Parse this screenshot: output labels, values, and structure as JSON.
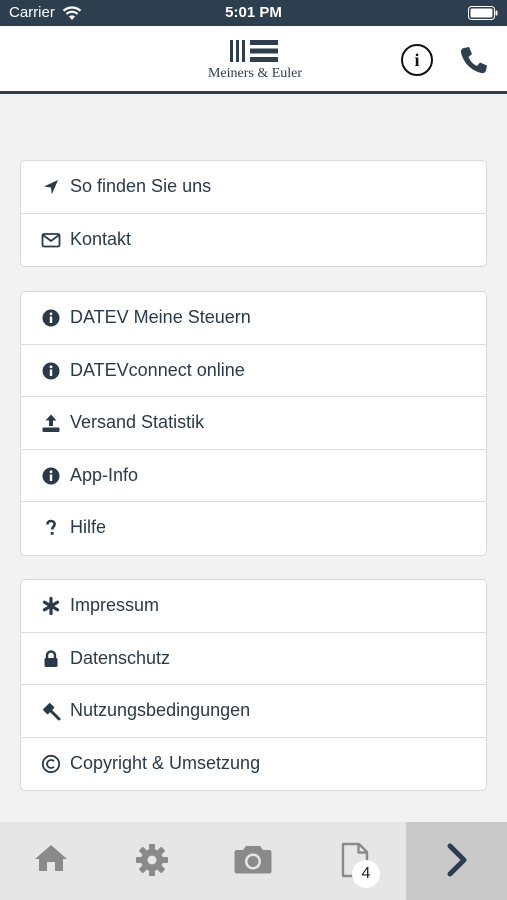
{
  "status_bar": {
    "carrier": "Carrier",
    "time": "5:01 PM"
  },
  "header": {
    "logo_text": "Meiners & Euler"
  },
  "groups": [
    {
      "items": [
        {
          "icon": "location-arrow-icon",
          "label": "So finden Sie uns"
        },
        {
          "icon": "envelope-icon",
          "label": "Kontakt"
        }
      ]
    },
    {
      "items": [
        {
          "icon": "info-circle-icon",
          "label": "DATEV Meine Steuern"
        },
        {
          "icon": "info-circle-icon",
          "label": "DATEVconnect online"
        },
        {
          "icon": "upload-icon",
          "label": "Versand Statistik"
        },
        {
          "icon": "info-circle-icon",
          "label": "App-Info"
        },
        {
          "icon": "question-icon",
          "label": "Hilfe"
        }
      ]
    },
    {
      "items": [
        {
          "icon": "asterisk-icon",
          "label": "Impressum"
        },
        {
          "icon": "lock-icon",
          "label": "Datenschutz"
        },
        {
          "icon": "gavel-icon",
          "label": "Nutzungsbedingungen"
        },
        {
          "icon": "copyright-icon",
          "label": "Copyright & Umsetzung"
        }
      ]
    }
  ],
  "tabbar": {
    "tabs": [
      "home-icon",
      "gear-icon",
      "camera-icon",
      "document-icon",
      "chevron-right-icon"
    ],
    "document_badge": "4"
  },
  "colors": {
    "navy": "#2d3e4f",
    "background": "#f2f2f2",
    "tabbar": "#e6e6e6",
    "tab_icon": "#8a8a8a"
  }
}
